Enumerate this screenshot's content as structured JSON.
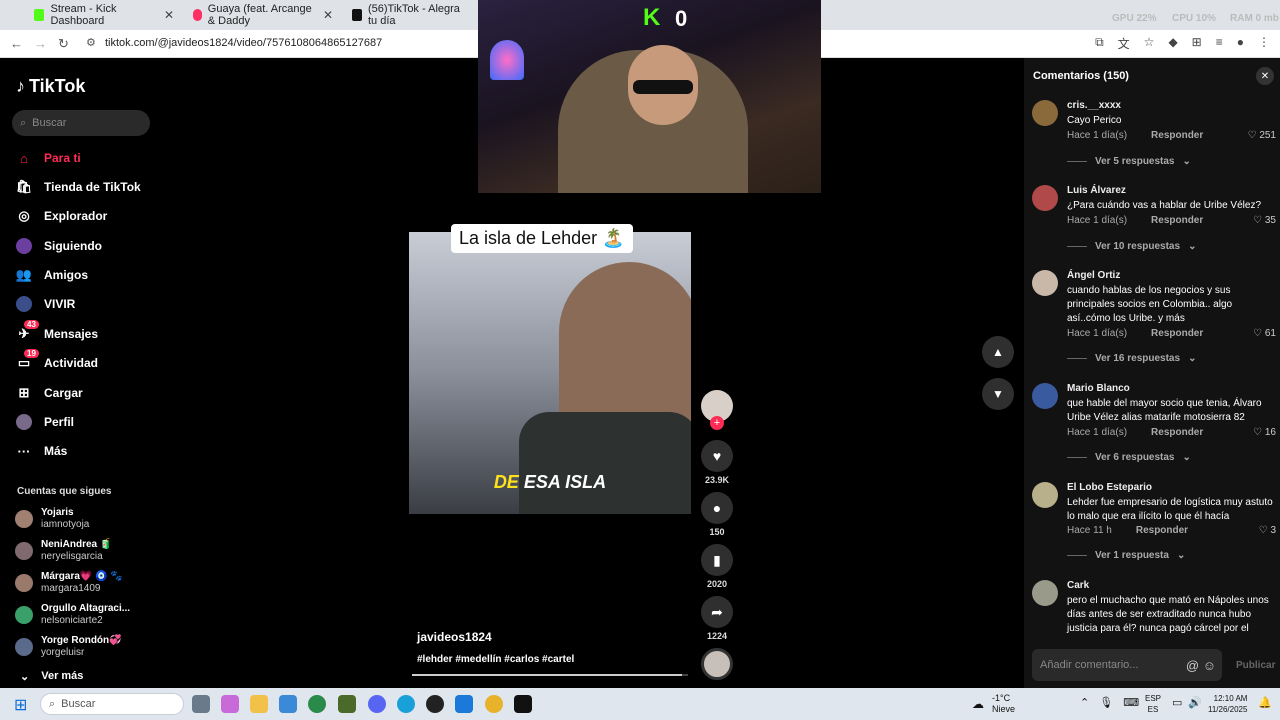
{
  "browser": {
    "tabs": [
      {
        "title": "Stream - Kick Dashboard",
        "color": "#53fc18"
      },
      {
        "title": "Guaya (feat. Arcange & Daddy",
        "color": "#ff2e63"
      },
      {
        "title": "(56)TikTok - Alegra tu día",
        "color": "#111111"
      }
    ],
    "url": "tiktok.com/@javideos1824/video/7576108064865127687",
    "overlay_gpu": "GPU 22%",
    "overlay_cpu": "CPU 10%",
    "overlay_ram": "RAM 0 mb"
  },
  "stream": {
    "viewer_count": "0"
  },
  "sidebar": {
    "logo": "TikTok",
    "search_placeholder": "Buscar",
    "items": [
      {
        "label": "Para ti",
        "icon": "home-icon"
      },
      {
        "label": "Tienda de TikTok",
        "icon": "shop-icon"
      },
      {
        "label": "Explorador",
        "icon": "compass-icon"
      },
      {
        "label": "Siguiendo",
        "icon": "following-icon"
      },
      {
        "label": "Amigos",
        "icon": "friends-icon"
      },
      {
        "label": "VIVIR",
        "icon": "live-icon"
      },
      {
        "label": "Mensajes",
        "icon": "messages-icon",
        "badge": "43"
      },
      {
        "label": "Actividad",
        "icon": "activity-icon",
        "badge": "19"
      },
      {
        "label": "Cargar",
        "icon": "upload-icon"
      },
      {
        "label": "Perfil",
        "icon": "profile-icon"
      },
      {
        "label": "Más",
        "icon": "more-icon"
      }
    ],
    "following_title": "Cuentas que sigues",
    "following": [
      {
        "name": "Yojaris",
        "user": "iamnotyoja"
      },
      {
        "name": "NeniAndrea 🧃",
        "user": "neryelisgarcia"
      },
      {
        "name": "Márgara💗 🧿 🐾",
        "user": "margara1409"
      },
      {
        "name": "Orgullo Altagraci...",
        "user": "nelsoniciarte2"
      },
      {
        "name": "Yorge Rondón💞",
        "user": "yorgeluisr"
      }
    ],
    "more_label": "Ver más"
  },
  "video": {
    "title_overlay": "La isla de Lehder 🏝️",
    "caption_highlight": "DE",
    "caption_rest": " ESA ISLA",
    "author": "javideos1824",
    "hashtags": "#lehder #medellín #carlos #cartel",
    "progress": 0.98,
    "likes": "23.9K",
    "comments": "150",
    "saves": "2020",
    "shares": "1224"
  },
  "comments_panel": {
    "title": "Comentarios (150)",
    "input_placeholder": "Añadir comentario...",
    "publish_label": "Publicar",
    "reply_label": "Responder",
    "items": [
      {
        "user": "cris.__xxxx",
        "text": "Cayo Perico",
        "time": "Hace 1 día(s)",
        "likes": "251",
        "replies": "Ver 5 respuestas",
        "avatar": "#8a6a3a"
      },
      {
        "user": "Luis Álvarez",
        "text": "¿Para cuándo vas a hablar de Uribe Vélez?",
        "time": "Hace 1 día(s)",
        "likes": "35",
        "replies": "Ver 10 respuestas",
        "avatar": "#b04a4a"
      },
      {
        "user": "Ángel Ortiz",
        "text": "cuando hablas de los negocios y sus principales socios en Colombia.. algo así..cómo los Uribe. y más",
        "time": "Hace 1 día(s)",
        "likes": "61",
        "replies": "Ver 16 respuestas",
        "avatar": "#c9b8a8"
      },
      {
        "user": "Mario Blanco",
        "text": "que hable del mayor socio que tenia, Álvaro Uribe Vélez alias matarife motosierra 82",
        "time": "Hace 1 día(s)",
        "likes": "16",
        "replies": "Ver 6 respuestas",
        "avatar": "#3a5aa0"
      },
      {
        "user": "El Lobo Estepario",
        "text": "Lehder fue empresario de logística muy astuto lo malo que era ilícito lo que él hacía",
        "time": "Hace 11 h",
        "likes": "3",
        "replies": "Ver 1 respuesta",
        "avatar": "#b8b08a"
      },
      {
        "user": "Cark",
        "text": "pero el muchacho que mató en Nápoles unos días antes de ser extraditado nunca hubo justicia para él? nunca pagó cárcel por el",
        "time": "",
        "likes": "",
        "replies": "",
        "avatar": "#9a9a8a"
      }
    ]
  },
  "taskbar": {
    "search_placeholder": "Buscar",
    "weather_temp": "-1°C",
    "weather_desc": "Nieve",
    "lang_top": "ESP",
    "lang_bottom": "ES",
    "time": "12:10 AM",
    "date": "11/26/2025"
  }
}
